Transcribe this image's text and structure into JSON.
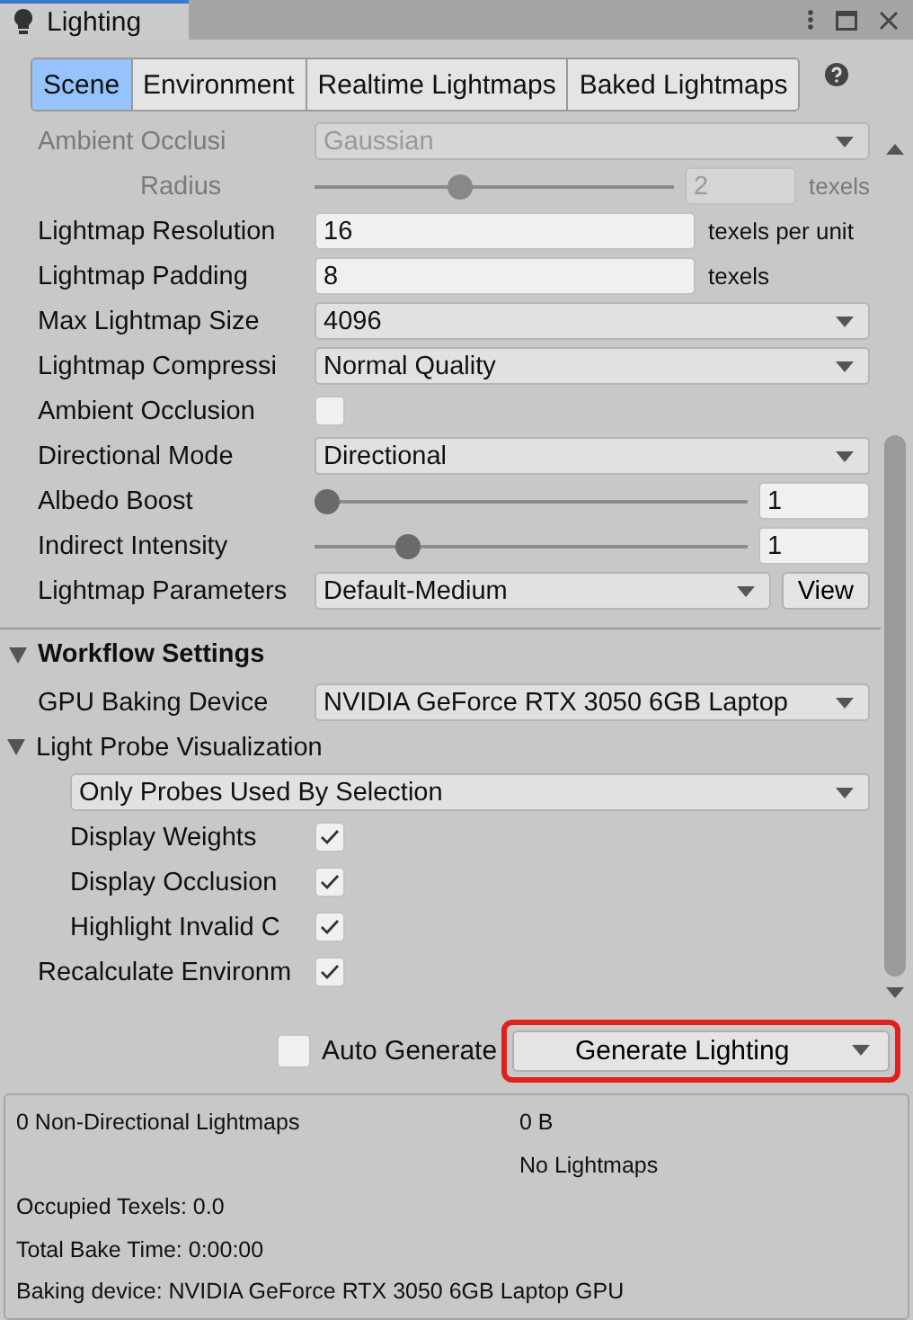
{
  "window": {
    "title": "Lighting"
  },
  "tabs": [
    {
      "label": "Scene",
      "selected": true
    },
    {
      "label": "Environment",
      "selected": false
    },
    {
      "label": "Realtime Lightmaps",
      "selected": false
    },
    {
      "label": "Baked Lightmaps",
      "selected": false
    }
  ],
  "settings": [
    {
      "kind": "dropdown",
      "label": "Ambient Occlusi",
      "value": "Gaussian",
      "disabled": true
    },
    {
      "kind": "slider",
      "label": "Radius",
      "level": 0.4,
      "value": "2",
      "unit": "texels",
      "disabled": true,
      "indented": true
    },
    {
      "kind": "field",
      "label": "Lightmap Resolution",
      "value": "16",
      "unit": "texels per unit"
    },
    {
      "kind": "field",
      "label": "Lightmap Padding",
      "value": "8",
      "unit": "texels"
    },
    {
      "kind": "dropdown",
      "label": "Max Lightmap Size",
      "value": "4096"
    },
    {
      "kind": "dropdown",
      "label": "Lightmap Compressi",
      "value": "Normal Quality"
    },
    {
      "kind": "checkbox",
      "label": "Ambient Occlusion",
      "checked": false
    },
    {
      "kind": "dropdown",
      "label": "Directional Mode",
      "value": "Directional"
    },
    {
      "kind": "slider",
      "label": "Albedo Boost",
      "level": 0,
      "value": "1"
    },
    {
      "kind": "slider",
      "label": "Indirect Intensity",
      "level": 0.2,
      "value": "1"
    },
    {
      "kind": "dropdown",
      "label": "Lightmap Parameters",
      "value": "Default-Medium",
      "button": "View"
    }
  ],
  "workflow": {
    "title": "Workflow Settings",
    "expanded": true,
    "items": [
      {
        "kind": "dropdown",
        "label": "GPU Baking Device",
        "value": "NVIDIA GeForce RTX 3050 6GB Laptop"
      },
      {
        "kind": "foldout",
        "label": "Light Probe Visualization",
        "expanded": true,
        "children": [
          {
            "kind": "dropdown",
            "value": "Only Probes Used By Selection"
          },
          {
            "kind": "checkbox",
            "label": "Display Weights",
            "checked": true
          },
          {
            "kind": "checkbox",
            "label": "Display Occlusion",
            "checked": true
          },
          {
            "kind": "checkbox",
            "label": "Highlight Invalid C",
            "checked": true
          }
        ]
      },
      {
        "kind": "checkbox",
        "label": "Recalculate Environm",
        "checked": true
      }
    ]
  },
  "auto_generate": {
    "label": "Auto Generate",
    "checked": false
  },
  "generate_button": {
    "label": "Generate Lighting",
    "highlighted": true
  },
  "stats": [
    {
      "left": "0 Non-Directional Lightmaps",
      "right": "0 B"
    },
    {
      "right": "No Lightmaps"
    },
    {
      "left": "Occupied Texels: 0.0"
    },
    {
      "left": "Total Bake Time: 0:00:00"
    },
    {
      "left": "Baking device: NVIDIA GeForce RTX 3050 6GB Laptop GPU"
    }
  ]
}
